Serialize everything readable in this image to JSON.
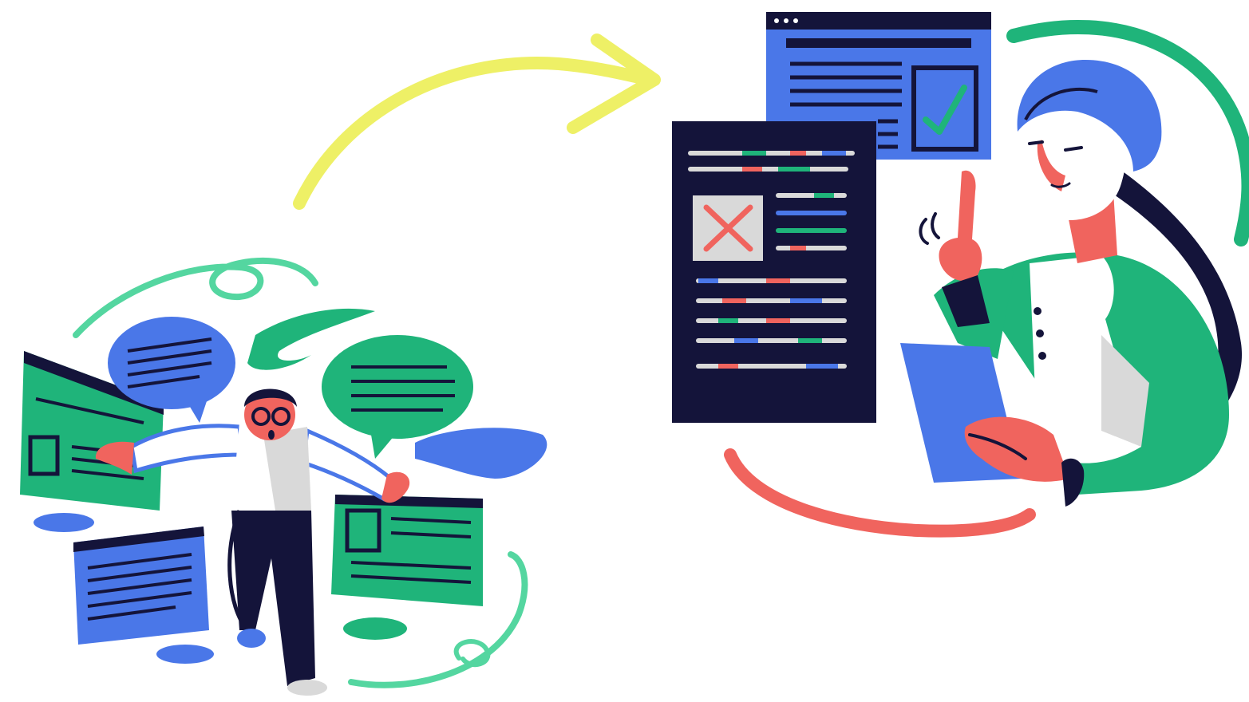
{
  "illustration": {
    "palette": {
      "navy": "#14143a",
      "blue": "#4a77e8",
      "green": "#1fb47a",
      "mint": "#54d6a0",
      "red": "#f0645e",
      "yellow": "#eef066",
      "gray": "#d9d9d9",
      "white": "#ffffff"
    },
    "scene_left": {
      "figure": "confused-man-surrounded-by-documents",
      "items": [
        "chat-bubble",
        "chat-bubble",
        "document-card",
        "document-card",
        "document-card",
        "document-card"
      ]
    },
    "connector": {
      "icon": "curved-arrow-icon",
      "direction": "left-to-right"
    },
    "scene_right": {
      "figure": "woman-explaining-with-tablet",
      "documents": [
        {
          "status": "rejected",
          "icon": "x-mark-icon"
        },
        {
          "status": "approved",
          "icon": "check-mark-icon"
        }
      ]
    }
  }
}
